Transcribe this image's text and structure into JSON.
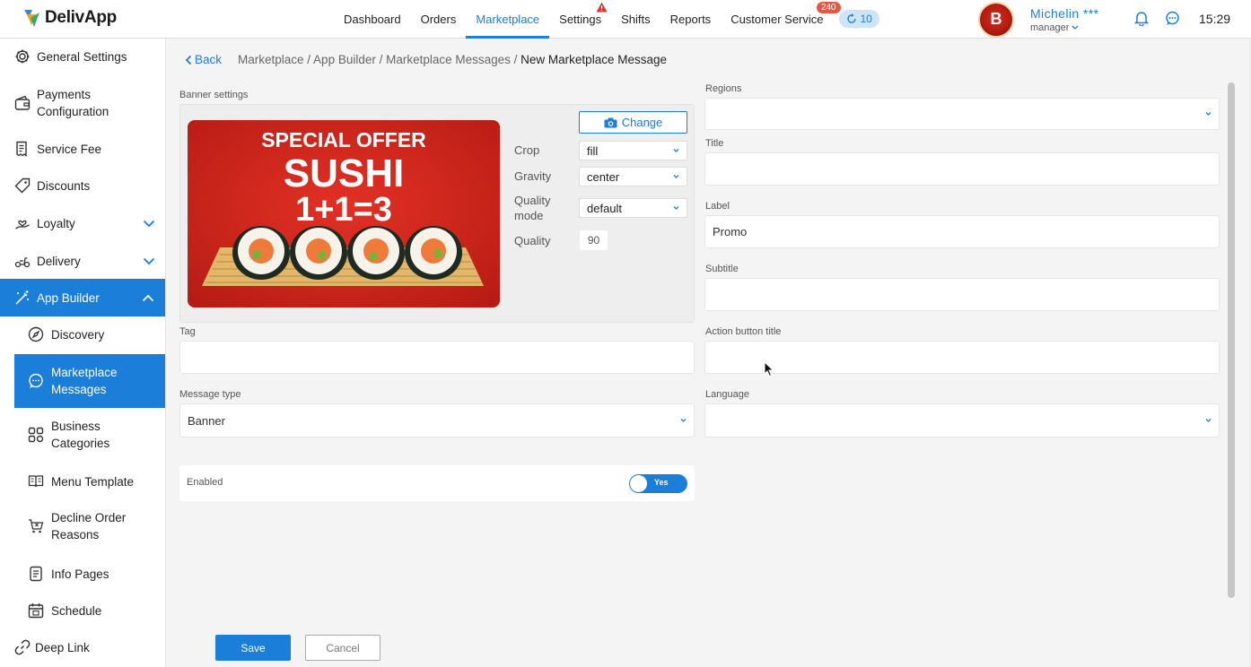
{
  "app": {
    "logo_text": "DelivApp"
  },
  "nav": {
    "items": [
      {
        "label": "Dashboard",
        "active": false
      },
      {
        "label": "Orders",
        "active": false
      },
      {
        "label": "Marketplace",
        "active": true
      },
      {
        "label": "Settings",
        "active": false
      },
      {
        "label": "Shifts",
        "active": false
      },
      {
        "label": "Reports",
        "active": false
      },
      {
        "label": "Customer Service",
        "active": false
      }
    ],
    "cs_badge": "240",
    "queue_count": "10"
  },
  "user": {
    "name": "Michelin ***",
    "role": "manager",
    "avatar_letter": "B"
  },
  "clock": "15:29",
  "sidebar": {
    "items": [
      {
        "label": "General Settings",
        "icon": "gear-icon"
      },
      {
        "label": "Payments Configuration",
        "icon": "wallet-icon"
      },
      {
        "label": "Service Fee",
        "icon": "receipt-icon"
      },
      {
        "label": "Discounts",
        "icon": "tag-icon"
      },
      {
        "label": "Loyalty",
        "icon": "hand-heart-icon"
      },
      {
        "label": "Delivery",
        "icon": "scooter-icon"
      },
      {
        "label": "App Builder",
        "icon": "magic-wand-icon"
      }
    ],
    "sub_items": [
      {
        "label": "Discovery",
        "icon": "compass-icon"
      },
      {
        "label": "Marketplace Messages",
        "icon": "chat-icon"
      },
      {
        "label": "Business Categories",
        "icon": "grid-icon"
      },
      {
        "label": "Menu Template",
        "icon": "book-icon"
      },
      {
        "label": "Decline Order Reasons",
        "icon": "cart-x-icon"
      },
      {
        "label": "Info Pages",
        "icon": "document-icon"
      },
      {
        "label": "Schedule",
        "icon": "calendar-icon"
      }
    ],
    "deep_link": {
      "label": "Deep Link",
      "icon": "link-icon"
    }
  },
  "breadcrumb": {
    "back": "Back",
    "path": "Marketplace / App Builder / Marketplace Messages / ",
    "current": "New Marketplace Message"
  },
  "banner": {
    "section_label": "Banner settings",
    "image_text": {
      "line1": "SPECIAL OFFER",
      "line2": "SUSHI",
      "line3": "1+1=3"
    },
    "change_label": "Change",
    "crop": {
      "label": "Crop",
      "value": "fill"
    },
    "gravity": {
      "label": "Gravity",
      "value": "center"
    },
    "quality_mode": {
      "label": "Quality mode",
      "value": "default"
    },
    "quality": {
      "label": "Quality",
      "value": "90"
    }
  },
  "form": {
    "tag": {
      "label": "Tag",
      "value": ""
    },
    "message_type": {
      "label": "Message type",
      "value": "Banner"
    },
    "enabled": {
      "label": "Enabled",
      "value": "Yes"
    },
    "regions": {
      "label": "Regions",
      "value": ""
    },
    "title": {
      "label": "Title",
      "value": ""
    },
    "label_field": {
      "label": "Label",
      "value": "Promo"
    },
    "subtitle": {
      "label": "Subtitle",
      "value": ""
    },
    "action_button_title": {
      "label": "Action button title",
      "value": ""
    },
    "language": {
      "label": "Language",
      "value": ""
    }
  },
  "actions": {
    "save": "Save",
    "cancel": "Cancel"
  },
  "colors": {
    "accent": "#1b7ed8",
    "banner_red": "#d8261b",
    "badge": "#e8573f"
  }
}
